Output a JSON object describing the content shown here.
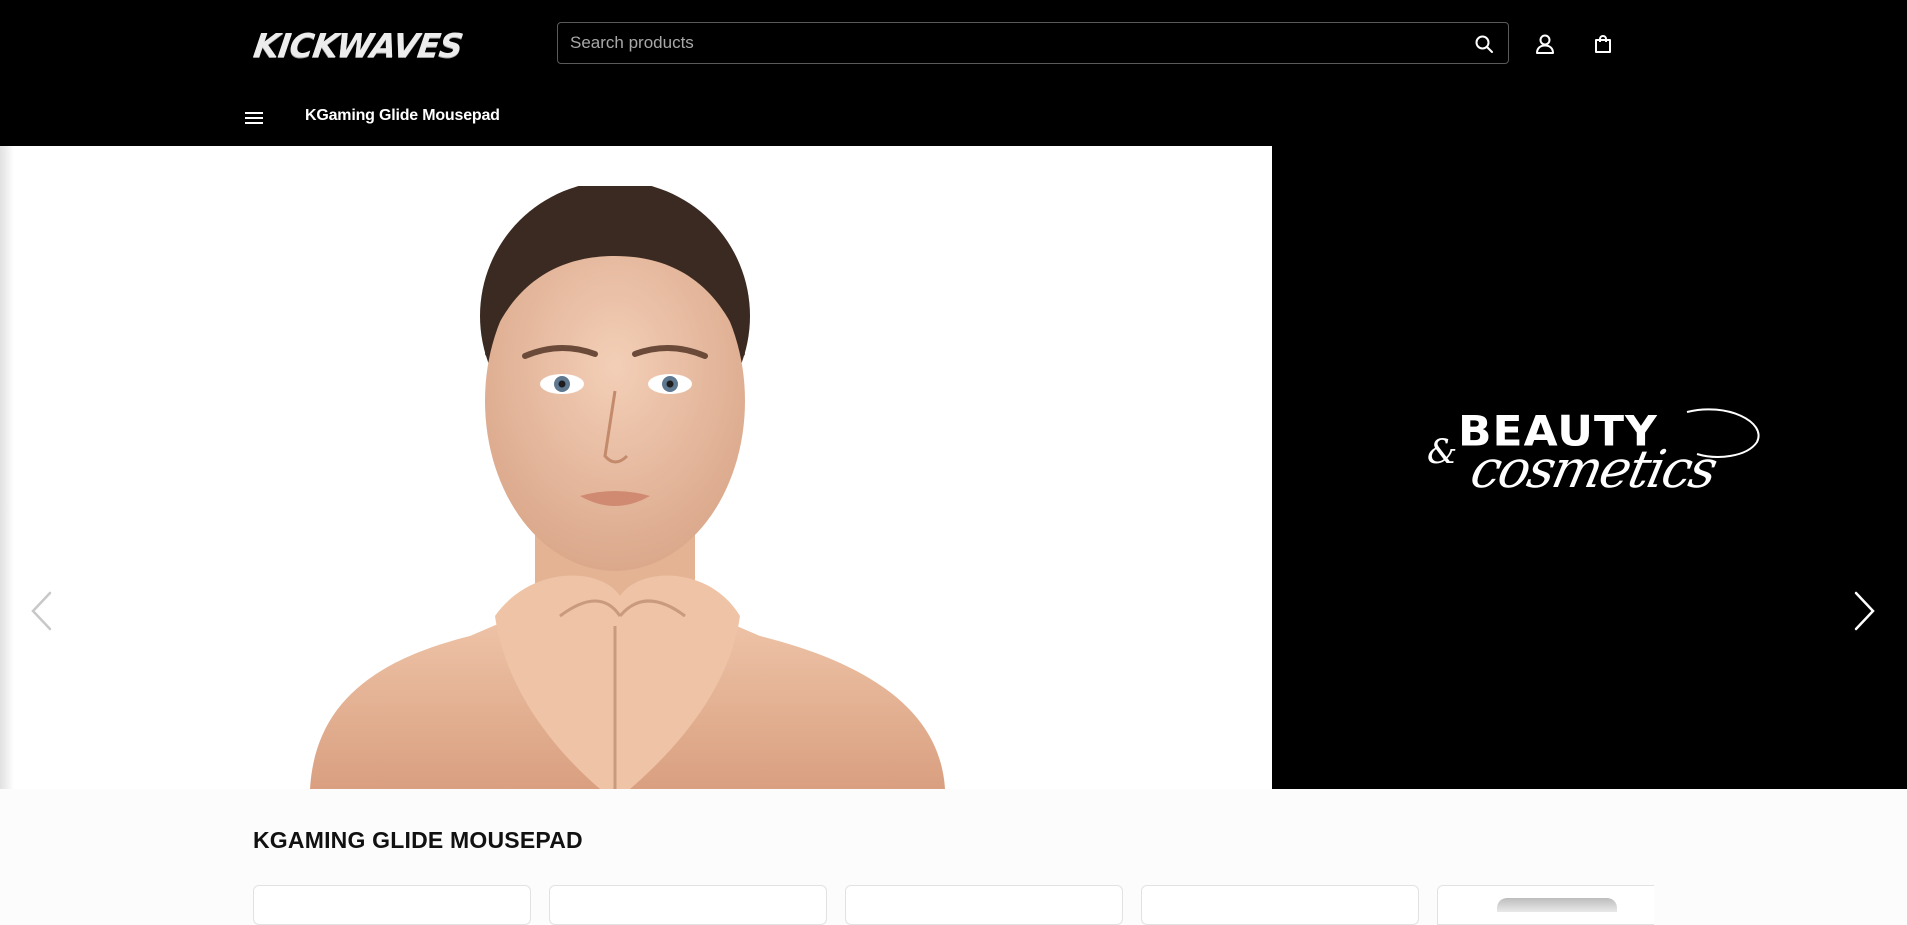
{
  "header": {
    "logo_text": "KICKWAVES",
    "search": {
      "placeholder": "Search products",
      "value": ""
    },
    "icons": [
      "search-icon",
      "account-icon",
      "cart-icon",
      "hamburger-menu-icon"
    ],
    "nav": {
      "link_label": "KGaming Glide Mousepad"
    }
  },
  "hero": {
    "slide_text": {
      "ampersand": "&",
      "beauty": "BEAUTY",
      "cosmetics": "cosmetics"
    },
    "controls": [
      "chevron-left-icon",
      "chevron-right-icon"
    ]
  },
  "collection": {
    "title": "KGAMING GLIDE MOUSEPAD",
    "card_count": 5
  },
  "colors": {
    "header_bg": "#000000",
    "page_bg": "#fcfcfc",
    "text_dark": "#111111"
  }
}
